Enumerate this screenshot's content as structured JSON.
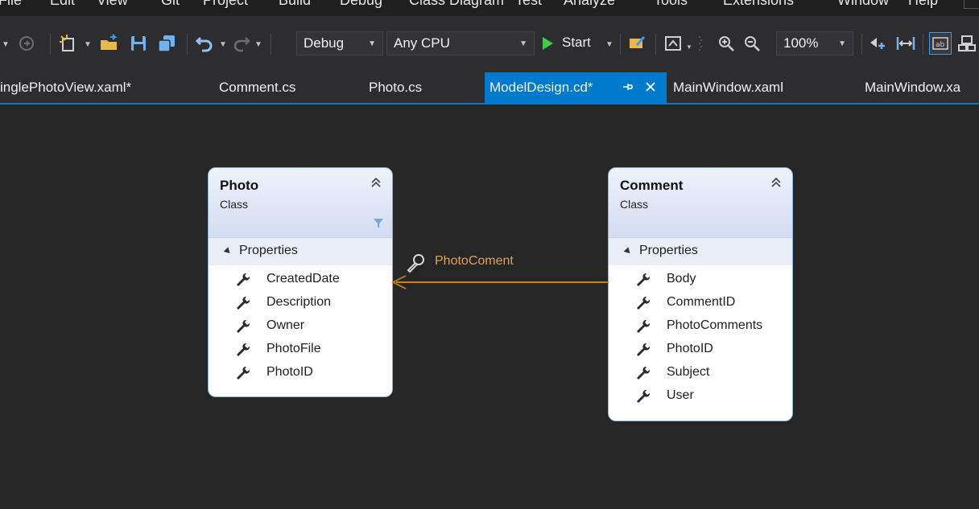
{
  "menu": [
    "File",
    "Edit",
    "View",
    "Git",
    "Project",
    "Build",
    "Debug",
    "Class Diagram",
    "Test",
    "Analyze",
    "Tools",
    "Extensions",
    "Window",
    "Help"
  ],
  "toolbar": {
    "config": "Debug",
    "platform": "Any CPU",
    "start_label": "Start",
    "zoom": "100%"
  },
  "tabs": [
    {
      "label": "inglePhotoView.xaml*"
    },
    {
      "label": "Comment.cs"
    },
    {
      "label": "Photo.cs"
    },
    {
      "label": "ModelDesign.cd*",
      "active": true
    },
    {
      "label": "MainWindow.xaml"
    },
    {
      "label": "MainWindow.xa"
    }
  ],
  "diagram": {
    "photo": {
      "name": "Photo",
      "kind": "Class",
      "section": "Properties",
      "properties": [
        "CreatedDate",
        "Description",
        "Owner",
        "PhotoFile",
        "PhotoID"
      ]
    },
    "comment": {
      "name": "Comment",
      "kind": "Class",
      "section": "Properties",
      "properties": [
        "Body",
        "CommentID",
        "PhotoComments",
        "PhotoID",
        "Subject",
        "User"
      ]
    },
    "association": "PhotoComent"
  },
  "colors": {
    "accent": "#007acc",
    "association": "#c5811f",
    "canvas": "#262626"
  }
}
